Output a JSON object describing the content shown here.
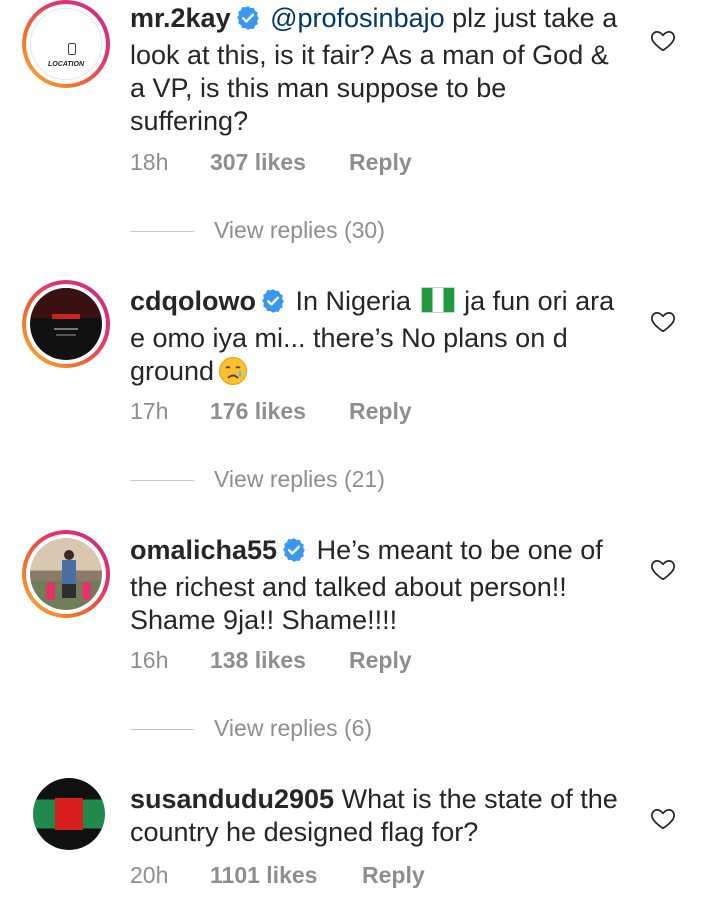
{
  "comments": [
    {
      "username": "mr.2kay",
      "verified": true,
      "mention": "@profosinbajo",
      "text": " plz just take a look at this, is it fair? As a man of God & a VP, is this man suppose to be suffering?",
      "avatar_caption": "LOCATION",
      "time": "18h",
      "likes": "307 likes",
      "reply": "Reply",
      "view_replies": "View replies (30)"
    },
    {
      "username": "cdqolowo",
      "verified": true,
      "text_before_flag": "In Nigeria",
      "text_after_flag": "ja fun ori ara e omo iya mi... there’s No plans on d ground",
      "time": "17h",
      "likes": "176 likes",
      "reply": "Reply",
      "view_replies": "View replies (21)"
    },
    {
      "username": "omalicha55",
      "verified": true,
      "text": "He’s meant to be one of the richest and talked about person!! Shame 9ja!! Shame!!!!",
      "time": "16h",
      "likes": "138 likes",
      "reply": "Reply",
      "view_replies": "View replies (6)"
    },
    {
      "username": "susandudu2905",
      "verified": false,
      "text": "What is the state of the country he designed flag for?",
      "time": "20h",
      "likes": "1101 likes",
      "reply": "Reply"
    }
  ],
  "colors": {
    "text": "#262626",
    "meta": "#8e8e8e",
    "mention": "#00376b",
    "verified": "#3897f0"
  }
}
